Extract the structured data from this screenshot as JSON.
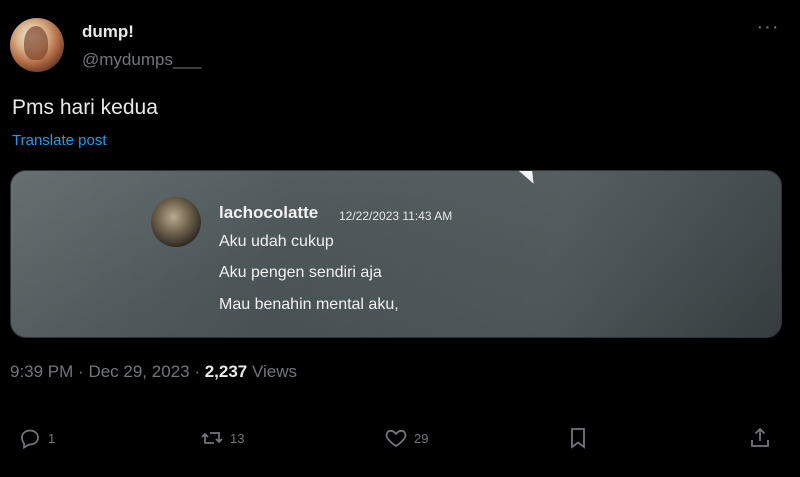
{
  "author": {
    "display_name": "dump!",
    "handle": "@mydumps___"
  },
  "post": {
    "text": "Pms hari kedua",
    "translate_label": "Translate post"
  },
  "media": {
    "username": "lachocolatte",
    "timestamp": "12/22/2023 11:43 AM",
    "lines": [
      "Aku udah cukup",
      "Aku pengen sendiri aja",
      "Mau benahin mental aku,"
    ]
  },
  "meta": {
    "time": "9:39 PM",
    "date": "Dec 29, 2023",
    "views_count": "2,237",
    "views_label": "Views"
  },
  "actions": {
    "reply_count": "1",
    "repost_count": "13",
    "like_count": "29"
  },
  "icons": {
    "more": "more-icon",
    "reply": "reply-icon",
    "repost": "repost-icon",
    "like": "heart-icon",
    "bookmark": "bookmark-icon",
    "share": "share-icon"
  },
  "colors": {
    "background": "#000000",
    "text": "#e7e9ea",
    "secondary": "#71767b",
    "link": "#1d9bf0"
  }
}
